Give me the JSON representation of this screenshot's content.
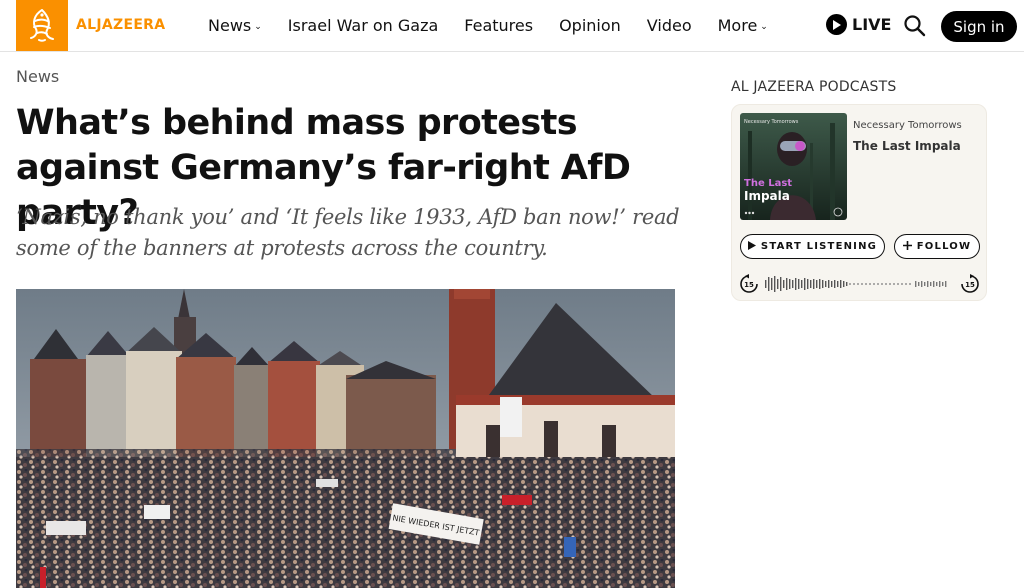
{
  "header": {
    "logo_text": "ALJAZEERA",
    "brand_color": "#fa9000",
    "nav": [
      {
        "label": "News",
        "dropdown": true
      },
      {
        "label": "Israel War on Gaza",
        "dropdown": false
      },
      {
        "label": "Features",
        "dropdown": false
      },
      {
        "label": "Opinion",
        "dropdown": false
      },
      {
        "label": "Video",
        "dropdown": false
      },
      {
        "label": "More",
        "dropdown": true
      }
    ],
    "live_label": "LIVE",
    "signin_label": "Sign in",
    "icons": {
      "live": "play-icon",
      "search": "search-icon",
      "dropdown": "chevron-down-icon"
    }
  },
  "article": {
    "section": "News",
    "headline": "What’s behind mass protests against Germany’s far-right AfD party?",
    "dek": "‘Nazis, no thank you’ and ‘It feels like 1933, AfD ban now!’ read some of the banners at protests across the country.",
    "image_banner_text": "NIE WIEDER IST JETZT"
  },
  "podcast": {
    "heading": "AL JAZEERA PODCASTS",
    "cover_brand": "Necessary Tomorrows",
    "cover_title_line1": "The Last",
    "cover_title_line2": "Impala",
    "show": "Necessary Tomorrows",
    "episode": "The Last Impala",
    "listen_label": "START LISTENING",
    "follow_label": "FOLLOW",
    "skip_back": "15",
    "skip_forward": "15",
    "icons": {
      "listen": "play-icon",
      "follow": "plus-icon",
      "back": "skip-back-icon",
      "forward": "skip-forward-icon"
    }
  }
}
